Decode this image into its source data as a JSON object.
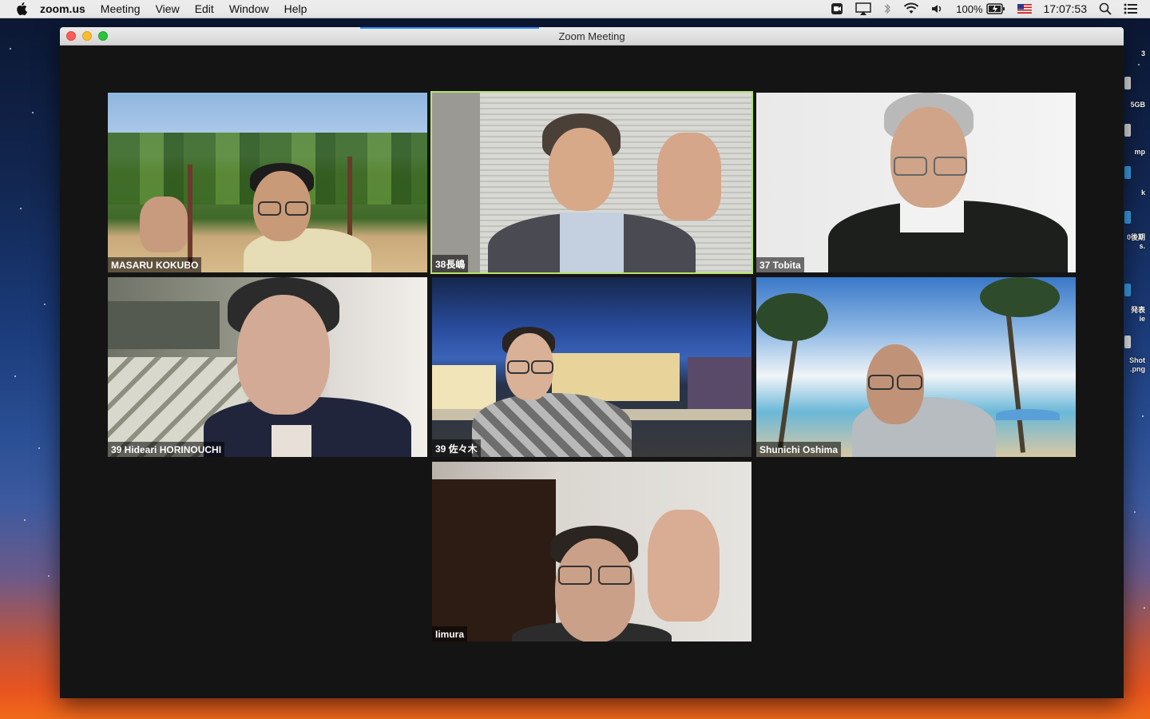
{
  "menubar": {
    "app_name": "zoom.us",
    "items": [
      "Meeting",
      "View",
      "Edit",
      "Window",
      "Help"
    ],
    "battery": "100%",
    "clock": "17:07:53"
  },
  "desktop_labels": [
    "3",
    "5GB",
    "mp",
    "k",
    "0後期\ns.",
    "発表\nie",
    "Shot\n.png"
  ],
  "window": {
    "title": "Zoom Meeting"
  },
  "participants": [
    {
      "name": "MASARU KOKUBO",
      "active": false
    },
    {
      "name": "38長嶋",
      "active": true
    },
    {
      "name": "37 Tobita",
      "active": false
    },
    {
      "name": "39 Hideari HORINOUCHI",
      "active": false
    },
    {
      "name": "39 佐々木",
      "active": false
    },
    {
      "name": "Shunichi Oshima",
      "active": false
    },
    {
      "name": "Iimura",
      "active": false
    }
  ],
  "colors": {
    "active_speaker_border": "#b6e36b",
    "window_background": "#141414",
    "progress_bar": "#2d8cff"
  }
}
